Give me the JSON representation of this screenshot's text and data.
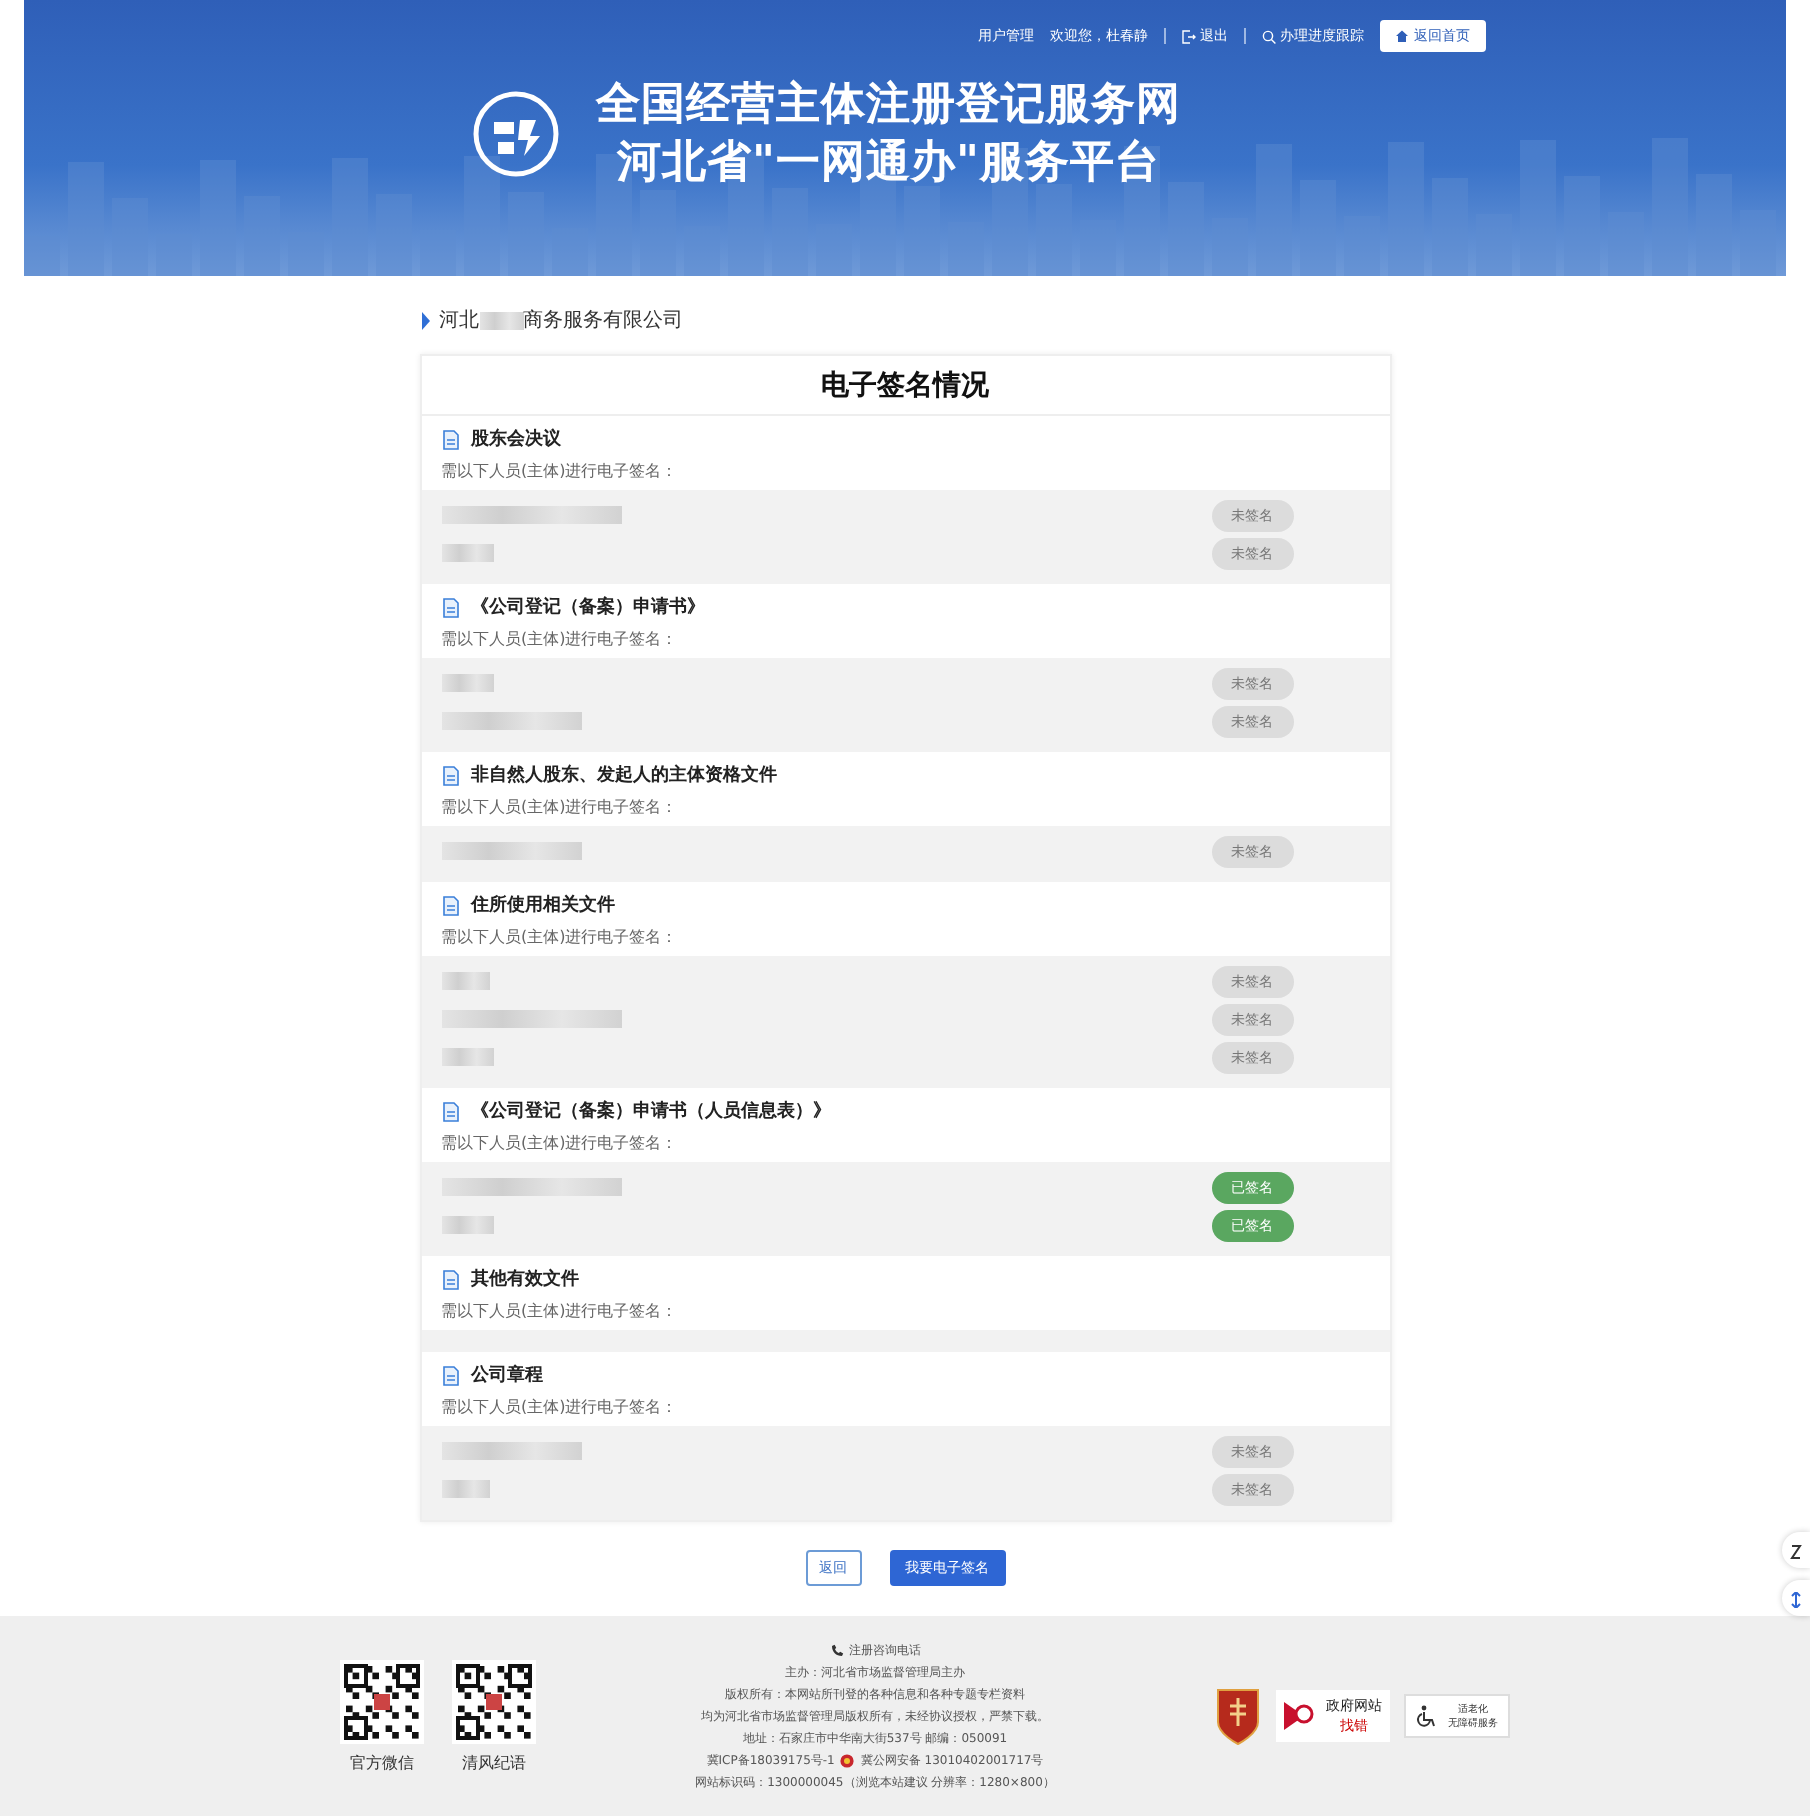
{
  "top_bar": {
    "links": [
      {
        "kind": "text",
        "label": "用户管理"
      },
      {
        "kind": "text",
        "label": "欢迎您，杜春静"
      },
      {
        "kind": "logout",
        "label": "退出"
      },
      {
        "kind": "search",
        "label": "办理进度跟踪"
      }
    ],
    "home_button": "返回首页"
  },
  "header": {
    "title_lines": [
      "全国经营主体注册登记服务网",
      "河北省\"一网通办\"服务平台"
    ]
  },
  "company": {
    "prefix": "河北",
    "suffix": "商务服务有限公司"
  },
  "panel": {
    "title": "电子签名情况",
    "sections": [
      {
        "title": "股东会决议",
        "subtitle": "需以下人员(主体)进行电子签名：",
        "rows": [
          {
            "signed": false,
            "status": "未签名"
          },
          {
            "signed": false,
            "status": "未签名"
          }
        ]
      },
      {
        "title": "《公司登记（备案）申请书》",
        "subtitle": "需以下人员(主体)进行电子签名：",
        "rows": [
          {
            "signed": false,
            "status": "未签名"
          },
          {
            "signed": false,
            "status": "未签名"
          }
        ]
      },
      {
        "title": "非自然人股东、发起人的主体资格文件",
        "subtitle": "需以下人员(主体)进行电子签名：",
        "rows": [
          {
            "signed": false,
            "status": "未签名"
          }
        ]
      },
      {
        "title": "住所使用相关文件",
        "subtitle": "需以下人员(主体)进行电子签名：",
        "rows": [
          {
            "signed": false,
            "status": "未签名"
          },
          {
            "signed": false,
            "status": "未签名"
          },
          {
            "signed": false,
            "status": "未签名"
          }
        ]
      },
      {
        "title": "《公司登记（备案）申请书（人员信息表）》",
        "subtitle": "需以下人员(主体)进行电子签名：",
        "rows": [
          {
            "signed": true,
            "status": "已签名"
          },
          {
            "signed": true,
            "status": "已签名"
          }
        ]
      },
      {
        "title": "其他有效文件",
        "subtitle": "需以下人员(主体)进行电子签名："
      },
      {
        "title": "公司章程",
        "subtitle": "需以下人员(主体)进行电子签名：",
        "rows": [
          {
            "signed": false,
            "status": "未签名"
          },
          {
            "signed": false,
            "status": "未签名"
          }
        ]
      }
    ]
  },
  "actions": {
    "back": "返回",
    "sign": "我要电子签名"
  },
  "footer": {
    "qr_codes": [
      "官方微信",
      "清风纪语"
    ],
    "hotline": "注册咨询电话",
    "lines": [
      "主办：河北省市场监督管理局主办",
      "版权所有：本网站所刊登的各种信息和各种专题专栏资料",
      "均为河北省市场监督管理局版权所有，未经协议授权，严禁下载。",
      "地址：石家庄市中华南大街537号 邮编：050091"
    ],
    "icp": "冀ICP备18039175号-1",
    "police": "冀公网安备 13010402001717号",
    "site_code": "网站标识码：1300000045（浏览本站建议 分辨率：1280×800）",
    "badges": [
      {
        "kind": "emblem"
      },
      {
        "kind": "error",
        "line1": "政府网站",
        "line2": "找错"
      },
      {
        "kind": "access",
        "line1": "适老化",
        "line2": "无障碍服务"
      }
    ]
  }
}
